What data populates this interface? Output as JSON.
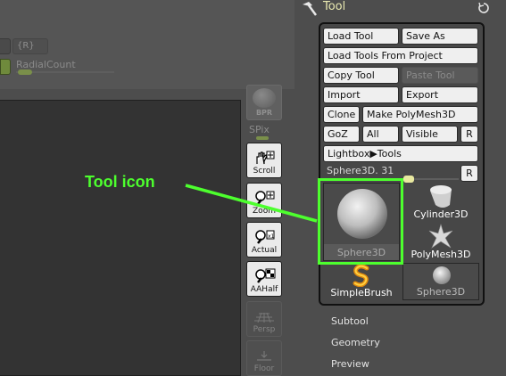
{
  "top": {
    "r_field": "{R}",
    "radial_label": "RadialCount"
  },
  "vbar": {
    "bpr": "BPR",
    "spix": "SPix",
    "scroll": "Scroll",
    "zoom": "Zoom",
    "actual": "Actual",
    "aahalf": "AAHalf",
    "persp": "Persp",
    "floor": "Floor"
  },
  "tool": {
    "title": "Tool",
    "buttons": {
      "load_tool": "Load Tool",
      "save_as": "Save As",
      "load_from_project": "Load Tools From Project",
      "copy_tool": "Copy Tool",
      "paste_tool": "Paste Tool",
      "import": "Import",
      "export": "Export",
      "clone": "Clone",
      "make_polymesh": "Make PolyMesh3D",
      "goz": "GoZ",
      "all": "All",
      "visible": "Visible",
      "r": "R",
      "lightbox": "Lightbox▶Tools"
    },
    "slider": {
      "label": "Sphere3D. 31",
      "r": "R"
    },
    "thumbnails": {
      "sphere": "Sphere3D",
      "cylinder": "Cylinder3D",
      "polymesh": "PolyMesh3D",
      "simplebrush": "SimpleBrush",
      "sphere_small": "Sphere3D"
    },
    "menus": [
      "Subtool",
      "Geometry",
      "Preview"
    ]
  },
  "annotation": {
    "callout": "Tool icon",
    "color": "#4dff2e"
  }
}
